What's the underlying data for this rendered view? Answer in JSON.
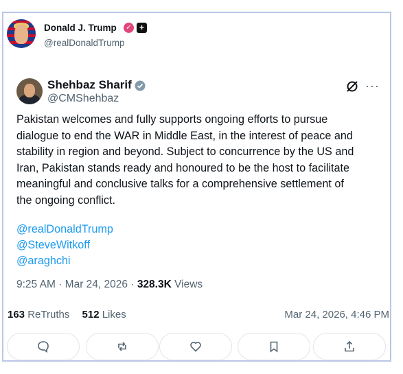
{
  "post": {
    "author_name": "Donald J. Trump",
    "author_handle": "@realDonaldTrump",
    "badges": [
      "verified-pink-badge",
      "plus-badge"
    ],
    "retruths_count": "163",
    "retruths_label": "ReTruths",
    "likes_count": "512",
    "likes_label": "Likes",
    "datetime": "Mar 24, 2026, 4:46 PM"
  },
  "quoted_tweet": {
    "author_name": "Shehbaz Sharif",
    "author_handle": "@CMShehbaz",
    "text": "Pakistan welcomes and fully supports ongoing efforts to pursue\ndialogue to end the WAR in Middle East, in the interest of peace and\nstability in region and beyond. Subject to concurrence by the US and\nIran, Pakistan stands ready and honoured to be the host to facilitate\nmeaningful and conclusive talks for a comprehensive settlement of\nthe ongoing conflict.",
    "mentions": [
      "@realDonaldTrump",
      "@SteveWitkoff",
      "@araghchi"
    ],
    "time": "9:25 AM",
    "date": "Mar 24, 2026",
    "views_count": "328.3K",
    "views_label": "Views",
    "more_label": "···"
  },
  "actions": [
    "reply-icon",
    "retruth-icon",
    "like-icon",
    "bookmark-icon",
    "share-icon"
  ],
  "colors": {
    "border": "#b9c7e6",
    "link": "#1d9bf0",
    "muted": "#536471",
    "pink_badge": "#e0457b"
  }
}
